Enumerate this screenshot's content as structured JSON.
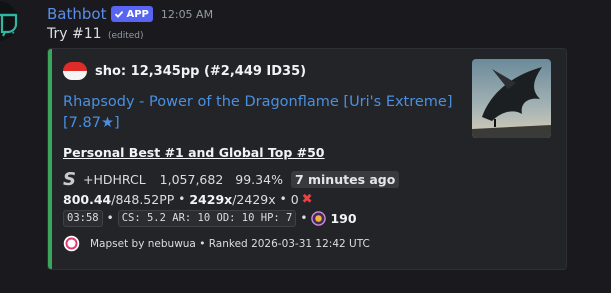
{
  "message": {
    "username": "Bathbot",
    "badge": "APP",
    "timestamp": "12:05 AM",
    "content": "Try #11",
    "edited": "(edited)"
  },
  "embed": {
    "accent_color": "#3ba55c",
    "author": "sho: 12,345pp (#2,449 ID35)",
    "title": "Rhapsody - Power of the Dragonflame [Uri's Extreme] [7.87★]",
    "personal_best": "Personal Best #1 and Global Top #50",
    "grade": "S",
    "mods": "+HDHRCL",
    "score": "1,057,682",
    "accuracy": "99.34%",
    "time_ago": "7 minutes ago",
    "pp": "800.44",
    "pp_max": "/848.52PP",
    "bullet": "•",
    "combo": "2429x",
    "combo_max": "/2429x",
    "misses": "0",
    "miss_icon": "✖",
    "length": "03:58",
    "stats": "CS: 5.2 AR: 10 OD: 10 HP: 7",
    "bpm": "190",
    "footer": "Mapset by nebuwua • Ranked 2026-03-31 12:42 UTC"
  }
}
